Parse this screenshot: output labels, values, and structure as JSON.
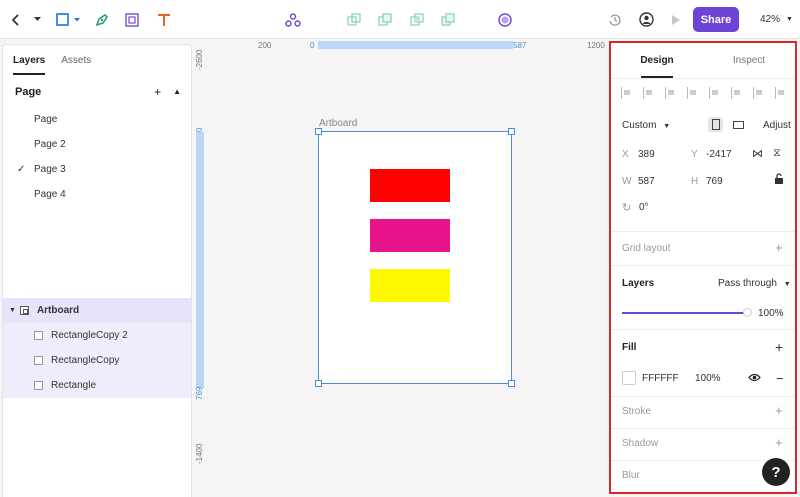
{
  "toolbar": {
    "share_label": "Share",
    "zoom": "42%"
  },
  "left_panel": {
    "tabs": [
      "Layers",
      "Assets"
    ],
    "page_header": "Page",
    "pages": [
      {
        "label": "Page",
        "selected": false
      },
      {
        "label": "Page 2",
        "selected": false
      },
      {
        "label": "Page 3",
        "selected": true
      },
      {
        "label": "Page 4",
        "selected": false
      }
    ],
    "layers": {
      "board": "Artboard",
      "children": [
        "RectangleCopy 2",
        "RectangleCopy",
        "Rectangle"
      ]
    }
  },
  "rulers": {
    "top": [
      "200",
      "0",
      "587",
      "1200"
    ],
    "left": [
      "-2600",
      "0",
      "769",
      "-1400"
    ]
  },
  "canvas": {
    "artboard_label": "Artboard",
    "rectangles": [
      {
        "name": "RectangleCopy 2",
        "color": "#ff0000"
      },
      {
        "name": "RectangleCopy",
        "color": "#e8128a"
      },
      {
        "name": "Rectangle",
        "color": "#fff700"
      }
    ]
  },
  "right_panel": {
    "tabs": [
      "Design",
      "Inspect"
    ],
    "size_preset": "Custom",
    "adjust_label": "Adjust",
    "x_label": "X",
    "x_value": "389",
    "y_label": "Y",
    "y_value": "-2417",
    "w_label": "W",
    "w_value": "587",
    "h_label": "H",
    "h_value": "769",
    "rotation": "0°",
    "grid_layout": "Grid layout",
    "layers_label": "Layers",
    "blend_mode": "Pass through",
    "opacity": "100%",
    "fill_label": "Fill",
    "fill_hex": "FFFFFF",
    "fill_opacity": "100%",
    "stroke_label": "Stroke",
    "shadow_label": "Shadow",
    "blur_label": "Blur"
  },
  "help_label": "?"
}
